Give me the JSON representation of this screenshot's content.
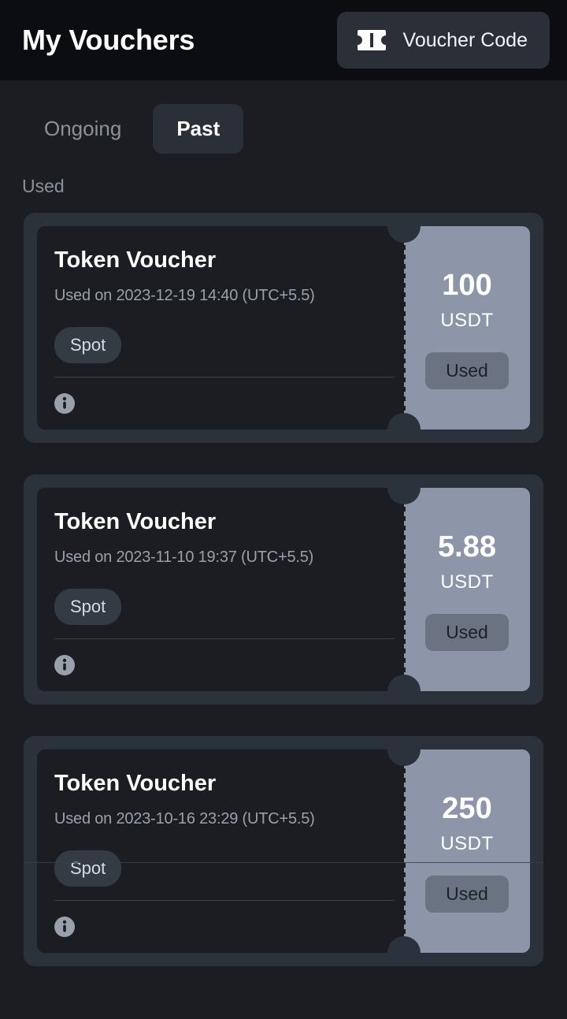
{
  "header": {
    "title": "My Vouchers",
    "voucher_code_button": {
      "label": "Voucher Code",
      "icon": "ticket-icon"
    }
  },
  "tabs": [
    {
      "label": "Ongoing",
      "active": false
    },
    {
      "label": "Past",
      "active": true
    }
  ],
  "section_label": "Used",
  "colors": {
    "page_background": "#1b1d22",
    "header_background": "#0b0d10",
    "card_outer": "#2b323c",
    "card_body": "#1b1d22",
    "stub": "#8d96a8",
    "status_badge": "#6b7382",
    "chip": "#343b45",
    "muted_text": "#8b919c",
    "white_text": "#ffffff"
  },
  "vouchers": [
    {
      "name": "Token Voucher",
      "date": "Used on 2023-12-19 14:40 (UTC+5.5)",
      "chip": "Spot",
      "amount": "100",
      "currency": "USDT",
      "status": "Used",
      "info_icon": "info-icon",
      "extra_hairline": false
    },
    {
      "name": "Token Voucher",
      "date": "Used on 2023-11-10 19:37 (UTC+5.5)",
      "chip": "Spot",
      "amount": "5.88",
      "currency": "USDT",
      "status": "Used",
      "info_icon": "info-icon",
      "extra_hairline": false
    },
    {
      "name": "Token Voucher",
      "date": "Used on 2023-10-16 23:29 (UTC+5.5)",
      "chip": "Spot",
      "amount": "250",
      "currency": "USDT",
      "status": "Used",
      "info_icon": "info-icon",
      "extra_hairline": true
    }
  ]
}
